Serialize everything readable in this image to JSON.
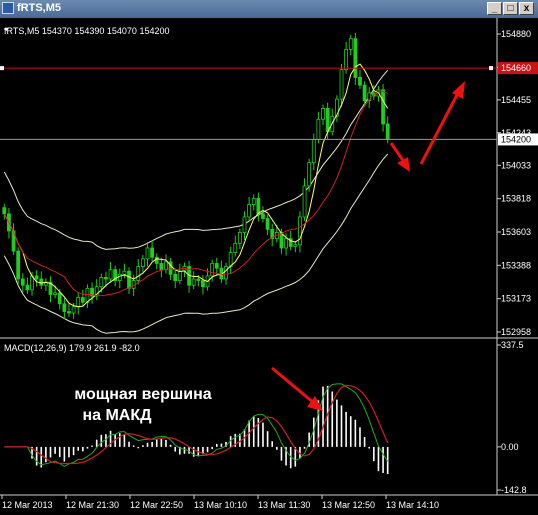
{
  "window": {
    "title": "fRTS,M5",
    "buttons": [
      "_",
      "□",
      "x"
    ]
  },
  "header": {
    "symbol_line": "fRTS,M5  154370 154390 154070 154200"
  },
  "price_axis": {
    "ticks": [
      "154880",
      "154665",
      "154455",
      "154243",
      "154033",
      "153818",
      "153603",
      "153388",
      "153173",
      "152958"
    ],
    "current_price_label": "154200",
    "hline_label": "154660"
  },
  "indicator": {
    "label": "MACD(12,26,9) 179.9 261.9 -82.0",
    "ticks": [
      "337.5",
      "0.00",
      "-142.8"
    ],
    "annotation_line1": "мощная вершина",
    "annotation_line2": "на МАКД"
  },
  "time_axis": {
    "labels": [
      "12 Mar 2013",
      "12 Mar 21:30",
      "12 Mar 22:50",
      "13 Mar 10:10",
      "13 Mar 11:30",
      "13 Mar 12:50",
      "13 Mar 14:10"
    ]
  },
  "colors": {
    "background": "#000000",
    "candles": "#22cc22",
    "ma_fast": "#ffff66",
    "ma_slow": "#cc2222",
    "envelope": "#e8e8c8",
    "hline": "#cc1111",
    "arrows": "#ee1111",
    "macd_hist": "#ffffff",
    "macd_signal": "#cc2222",
    "macd_main": "#22aa22"
  },
  "chart_data": {
    "type": "candlestick",
    "x": [
      "12 Mar 2013",
      "12 Mar 21:30",
      "12 Mar 22:50",
      "13 Mar 10:10",
      "13 Mar 11:30",
      "13 Mar 12:50",
      "13 Mar 14:10"
    ],
    "close": [
      153720,
      153610,
      153480,
      153300,
      153260,
      153230,
      153320,
      153300,
      153260,
      153280,
      153200,
      153210,
      153140,
      153090,
      153080,
      153120,
      153180,
      153150,
      153240,
      153190,
      153250,
      153310,
      153300,
      153360,
      153290,
      153330,
      153350,
      153240,
      153290,
      153380,
      153430,
      153500,
      153440,
      153400,
      153360,
      153410,
      153330,
      153290,
      153350,
      153380,
      153260,
      153300,
      153290,
      153250,
      153320,
      153400,
      153370,
      153300,
      153380,
      153470,
      153530,
      153600,
      153700,
      153780,
      153820,
      153720,
      153690,
      153620,
      153560,
      153600,
      153500,
      153560,
      153510,
      153520,
      153700,
      153900,
      154050,
      154200,
      154330,
      154400,
      154250,
      154350,
      154460,
      154650,
      154780,
      154850,
      154600,
      154550,
      154450,
      154500,
      154480,
      154520,
      154300,
      154200
    ],
    "ylim": [
      152958,
      154880
    ],
    "hline": 154660,
    "macd": {
      "label": "MACD(12,26,9) 179.9 261.9 -82.0",
      "main": 179.9,
      "signal": 261.9,
      "hist": -82.0,
      "ylim": [
        -142.8,
        337.5
      ]
    }
  }
}
